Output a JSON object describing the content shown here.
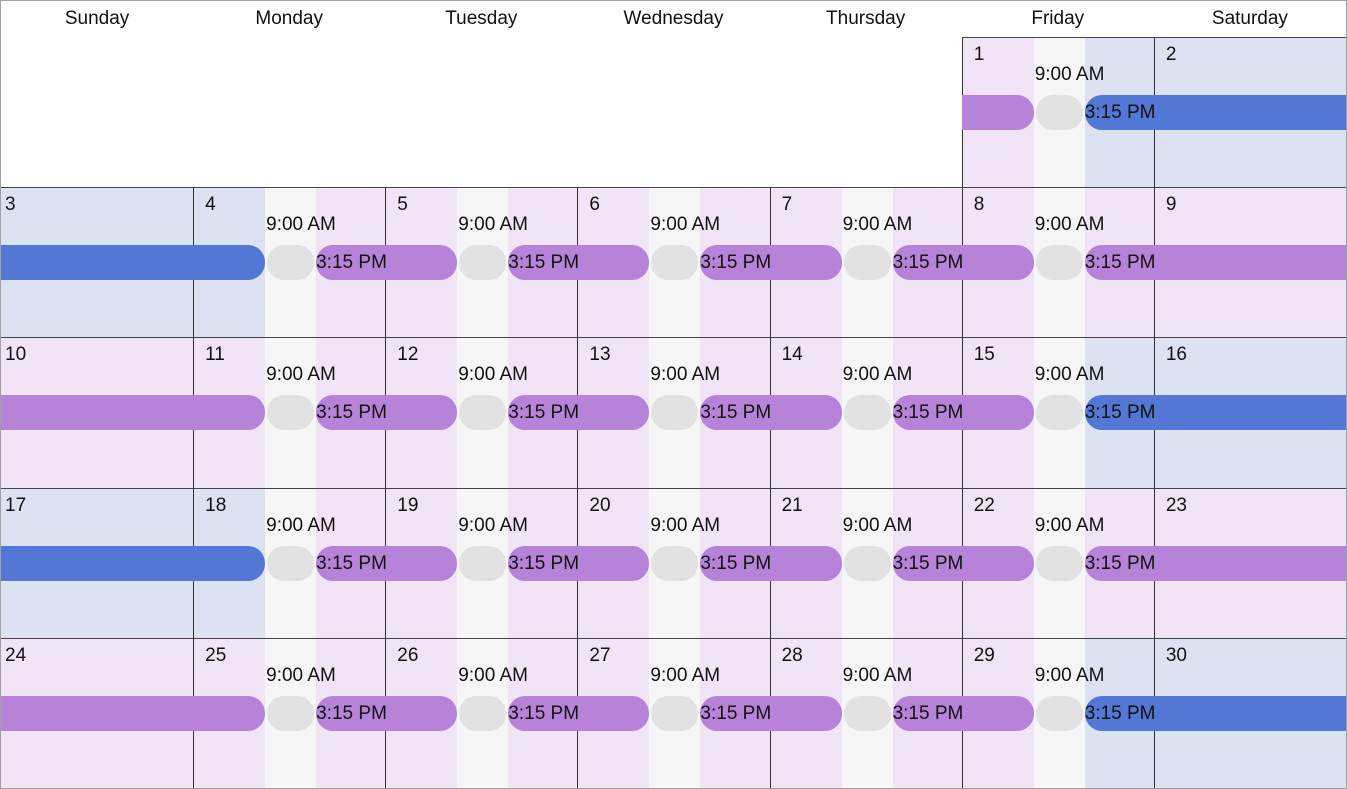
{
  "calendar": {
    "weekdays": [
      "Sunday",
      "Monday",
      "Tuesday",
      "Wednesday",
      "Thursday",
      "Friday",
      "Saturday"
    ],
    "first_day_column": 5,
    "days_in_month": 30,
    "colors": {
      "pink_bg": "#f1e4f6",
      "blue_bg": "#dde2f3",
      "gray_bg": "#f6f6f6",
      "purple_event": "#b683d9",
      "blue_event": "#5277d4",
      "gray_event": "#e2e2e2"
    },
    "start_label": "9:00 AM",
    "end_label": "3:15 PM",
    "shifts": [
      {
        "from_day": 0,
        "to_day": 1,
        "type": "purple"
      },
      {
        "from_day": 1,
        "to_day": 4,
        "type": "blue"
      },
      {
        "from_day": 4,
        "to_day": 5,
        "type": "purple"
      },
      {
        "from_day": 5,
        "to_day": 6,
        "type": "purple"
      },
      {
        "from_day": 6,
        "to_day": 7,
        "type": "purple"
      },
      {
        "from_day": 7,
        "to_day": 8,
        "type": "purple"
      },
      {
        "from_day": 8,
        "to_day": 11,
        "type": "purple"
      },
      {
        "from_day": 11,
        "to_day": 12,
        "type": "purple"
      },
      {
        "from_day": 12,
        "to_day": 13,
        "type": "purple"
      },
      {
        "from_day": 13,
        "to_day": 14,
        "type": "purple"
      },
      {
        "from_day": 14,
        "to_day": 15,
        "type": "purple"
      },
      {
        "from_day": 15,
        "to_day": 18,
        "type": "blue"
      },
      {
        "from_day": 18,
        "to_day": 19,
        "type": "purple"
      },
      {
        "from_day": 19,
        "to_day": 20,
        "type": "purple"
      },
      {
        "from_day": 20,
        "to_day": 21,
        "type": "purple"
      },
      {
        "from_day": 21,
        "to_day": 22,
        "type": "purple"
      },
      {
        "from_day": 22,
        "to_day": 25,
        "type": "purple"
      },
      {
        "from_day": 25,
        "to_day": 26,
        "type": "purple"
      },
      {
        "from_day": 26,
        "to_day": 27,
        "type": "purple"
      },
      {
        "from_day": 27,
        "to_day": 28,
        "type": "purple"
      },
      {
        "from_day": 28,
        "to_day": 29,
        "type": "purple"
      },
      {
        "from_day": 29,
        "to_day": 31,
        "type": "blue"
      }
    ]
  }
}
